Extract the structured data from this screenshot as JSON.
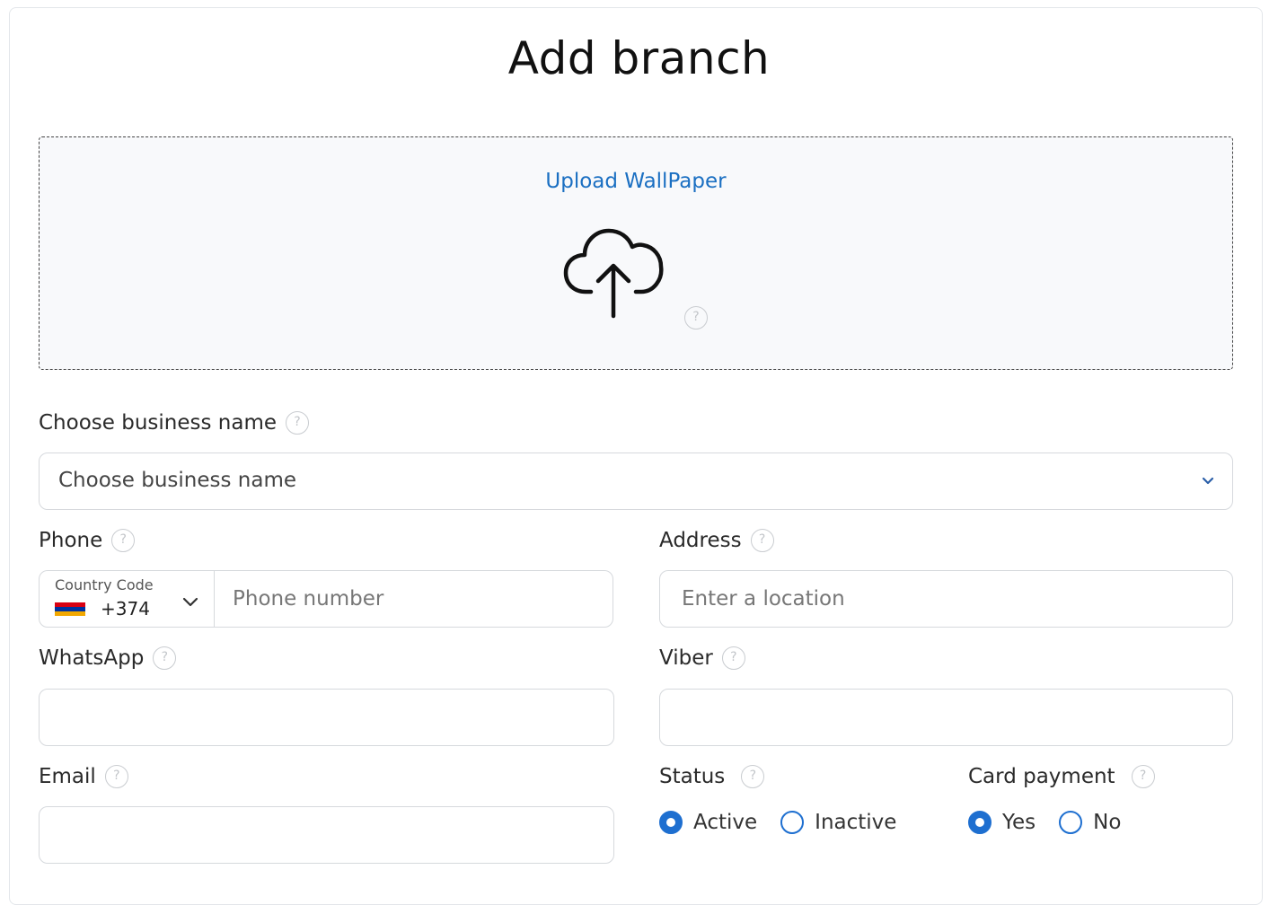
{
  "page": {
    "title": "Add branch"
  },
  "upload": {
    "label": "Upload WallPaper"
  },
  "business": {
    "label": "Choose business name",
    "placeholder": "Choose business name"
  },
  "phone": {
    "label": "Phone",
    "country_code_label": "Country Code",
    "country_code_value": "+374",
    "placeholder": "Phone number"
  },
  "address": {
    "label": "Address",
    "placeholder": "Enter a location"
  },
  "whatsapp": {
    "label": "WhatsApp",
    "value": ""
  },
  "viber": {
    "label": "Viber",
    "value": ""
  },
  "email": {
    "label": "Email",
    "value": ""
  },
  "status": {
    "label": "Status",
    "options": [
      {
        "label": "Active",
        "checked": true
      },
      {
        "label": "Inactive",
        "checked": false
      }
    ]
  },
  "card_payment": {
    "label": "Card payment",
    "options": [
      {
        "label": "Yes",
        "checked": true
      },
      {
        "label": "No",
        "checked": false
      }
    ]
  },
  "help_glyph": "?",
  "colors": {
    "accent": "#1e6fd0",
    "link": "#1a6fc2"
  },
  "flag_colors": [
    "#d90012",
    "#0033a0",
    "#f2a800"
  ]
}
